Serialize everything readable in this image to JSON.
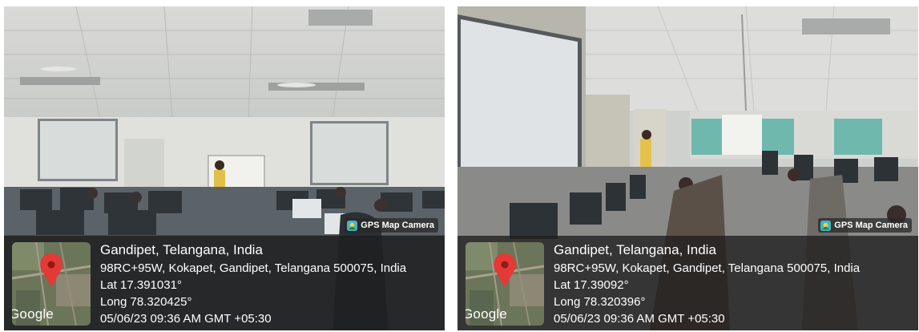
{
  "photos": [
    {
      "location_title": "Gandipet, Telangana, India",
      "address": "98RC+95W, Kokapet, Gandipet, Telangana 500075, India",
      "latitude": "Lat 17.391031°",
      "longitude": "Long 78.320425°",
      "datetime": "05/06/23 09:36 AM GMT +05:30",
      "map_brand": "Google",
      "badge": "GPS Map Camera"
    },
    {
      "location_title": "Gandipet, Telangana, India",
      "address": "98RC+95W, Kokapet, Gandipet, Telangana 500075, India",
      "latitude": "Lat 17.39092°",
      "longitude": "Long 78.320396°",
      "datetime": "05/06/23 09:36 AM GMT +05:30",
      "map_brand": "Google",
      "badge": "GPS Map Camera"
    }
  ]
}
